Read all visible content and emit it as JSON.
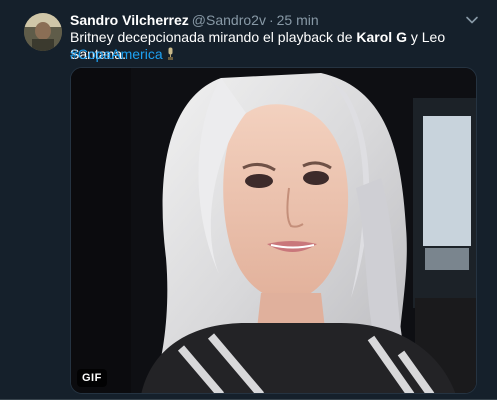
{
  "tweet": {
    "display_name": "Sandro Vilcherrez",
    "handle": "@Sandro2v",
    "separator": "·",
    "time": "25 min",
    "text_before": "Britney decepcionada mirando el playback de ",
    "text_bold": "Karol G",
    "text_after": " y Leo Santana.",
    "hashtag": "#CopaAmerica",
    "hashtag_emoji": "trophy-icon",
    "media_badge": "GIF"
  },
  "colors": {
    "background": "#15202b",
    "name": "#ffffff",
    "secondary": "#8899a6",
    "link": "#1da1f2"
  },
  "icons": {
    "menu": "chevron-down-icon",
    "avatar": "avatar"
  }
}
